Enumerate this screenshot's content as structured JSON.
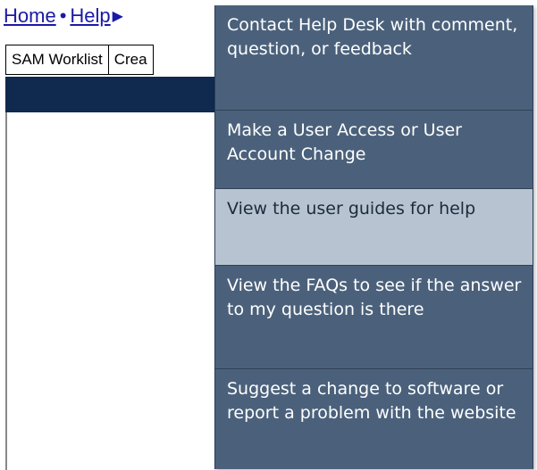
{
  "breadcrumb": {
    "home_label": "Home",
    "separator": "•",
    "help_label": "Help",
    "arrow_glyph": "▶"
  },
  "tabs": [
    {
      "label": "SAM Worklist"
    },
    {
      "label": "Crea"
    }
  ],
  "help_menu": {
    "items": [
      {
        "label": "Contact Help Desk with comment, question, or feedback",
        "highlighted": false
      },
      {
        "label": "Make a User Access or User Account Change",
        "highlighted": false
      },
      {
        "label": "View the user guides for help",
        "highlighted": true
      },
      {
        "label": "View the FAQs to see if the answer to my question is there",
        "highlighted": false
      },
      {
        "label": "Suggest a change to software or report a problem with the website",
        "highlighted": false
      }
    ]
  },
  "colors": {
    "menu_background": "#4b617b",
    "menu_highlight": "#b7c3d0",
    "nav_strip": "#0f2a4e",
    "link": "#1a1aa6"
  }
}
